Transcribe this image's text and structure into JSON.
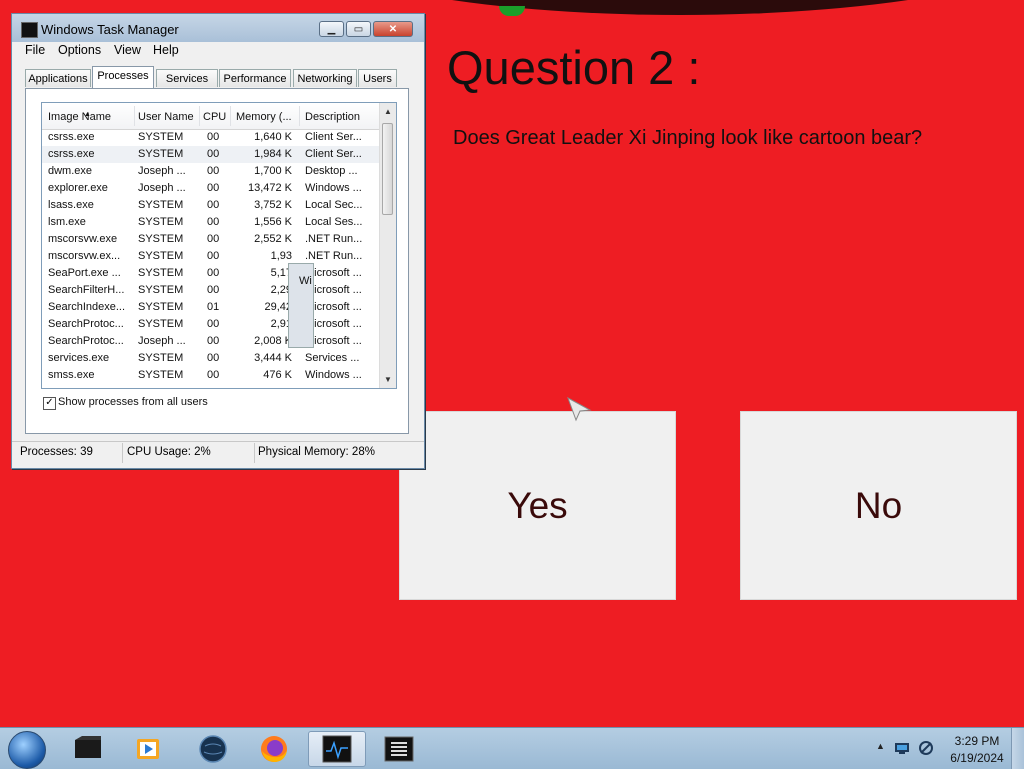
{
  "colors": {
    "background": "#ee1d23",
    "accent_dark": "#2b0b0b",
    "accent_green": "#1b9e2a",
    "button_bg": "#f0f0f0",
    "button_text": "#3a0a0a"
  },
  "quiz": {
    "title": "Question 2 :",
    "question": "Does Great Leader Xi Jinping look like cartoon bear?",
    "answers": {
      "yes": "Yes",
      "no": "No"
    }
  },
  "task_manager": {
    "title": "Windows Task Manager",
    "menu": [
      "File",
      "Options",
      "View",
      "Help"
    ],
    "tabs": [
      "Applications",
      "Processes",
      "Services",
      "Performance",
      "Networking",
      "Users"
    ],
    "active_tab": "Processes",
    "columns": [
      "Image Name",
      "User Name",
      "CPU",
      "Memory (...",
      "Description"
    ],
    "rows": [
      {
        "name": "csrss.exe",
        "user": "SYSTEM",
        "cpu": "00",
        "mem": "1,640 K",
        "desc": "Client Ser..."
      },
      {
        "name": "csrss.exe",
        "user": "SYSTEM",
        "cpu": "00",
        "mem": "1,984 K",
        "desc": "Client Ser..."
      },
      {
        "name": "dwm.exe",
        "user": "Joseph ...",
        "cpu": "00",
        "mem": "1,700 K",
        "desc": "Desktop ..."
      },
      {
        "name": "explorer.exe",
        "user": "Joseph ...",
        "cpu": "00",
        "mem": "13,472 K",
        "desc": "Windows ..."
      },
      {
        "name": "lsass.exe",
        "user": "SYSTEM",
        "cpu": "00",
        "mem": "3,752 K",
        "desc": "Local Sec..."
      },
      {
        "name": "lsm.exe",
        "user": "SYSTEM",
        "cpu": "00",
        "mem": "1,556 K",
        "desc": "Local Ses..."
      },
      {
        "name": "mscorsvw.exe",
        "user": "SYSTEM",
        "cpu": "00",
        "mem": "2,552 K",
        "desc": ".NET Run..."
      },
      {
        "name": "mscorsvw.ex...",
        "user": "SYSTEM",
        "cpu": "00",
        "mem": "1,93",
        "desc": ".NET Run..."
      },
      {
        "name": "SeaPort.exe ...",
        "user": "SYSTEM",
        "cpu": "00",
        "mem": "5,17",
        "desc": "Microsoft ..."
      },
      {
        "name": "SearchFilterH...",
        "user": "SYSTEM",
        "cpu": "00",
        "mem": "2,29",
        "desc": "Microsoft ..."
      },
      {
        "name": "SearchIndexe...",
        "user": "SYSTEM",
        "cpu": "01",
        "mem": "29,42",
        "desc": "Microsoft ..."
      },
      {
        "name": "SearchProtoc...",
        "user": "SYSTEM",
        "cpu": "00",
        "mem": "2,91",
        "desc": "Microsoft ..."
      },
      {
        "name": "SearchProtoc...",
        "user": "Joseph ...",
        "cpu": "00",
        "mem": "2,008 K",
        "desc": "Microsoft ..."
      },
      {
        "name": "services.exe",
        "user": "SYSTEM",
        "cpu": "00",
        "mem": "3,444 K",
        "desc": "Services ..."
      },
      {
        "name": "smss.exe",
        "user": "SYSTEM",
        "cpu": "00",
        "mem": "476 K",
        "desc": "Windows ..."
      }
    ],
    "selected_row": 1,
    "overlap_dialog_fragment": "Wi",
    "show_all_users_label": "Show processes from all users",
    "show_all_users_checked": true,
    "status": {
      "processes": "Processes: 39",
      "cpu": "CPU Usage: 2%",
      "memory": "Physical Memory: 28%"
    }
  },
  "taskbar": {
    "items": [
      "terminal-icon",
      "media-player-icon",
      "globe-icon",
      "firefox-icon",
      "task-manager-icon",
      "console-icon"
    ],
    "active_item": "task-manager-icon",
    "time": "3:29 PM",
    "date": "6/19/2024"
  }
}
